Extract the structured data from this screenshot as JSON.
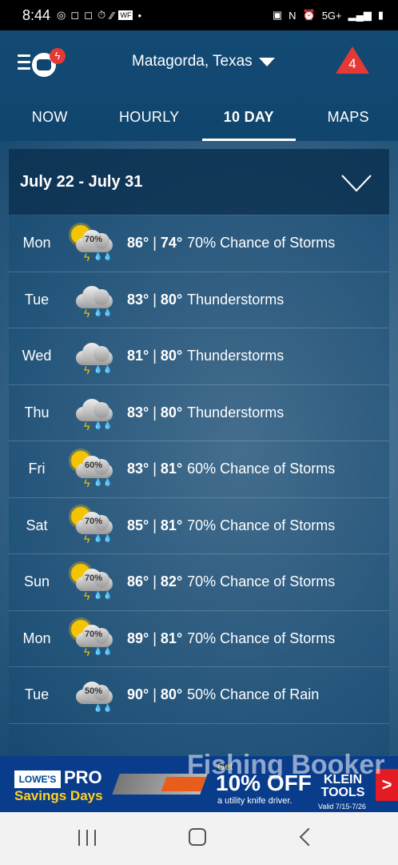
{
  "status_bar": {
    "time": "8:44",
    "left_icons": [
      "threads-icon",
      "instagram-icon",
      "instagram-icon",
      "timer-icon",
      "wifi-calling-icon",
      "wf-icon",
      "dot-icon"
    ],
    "network": "5G+",
    "right_icons": [
      "lock-icon",
      "nfc-icon",
      "alarm-icon",
      "5g-icon",
      "signal-icon",
      "battery-icon"
    ]
  },
  "header": {
    "location": "Matagorda, Texas",
    "alert_count": "4"
  },
  "tabs": [
    {
      "label": "NOW",
      "active": false
    },
    {
      "label": "HOURLY",
      "active": false
    },
    {
      "label": "10 DAY",
      "active": true
    },
    {
      "label": "MAPS",
      "active": false
    }
  ],
  "forecast": {
    "range": "July 22 - July 31",
    "days": [
      {
        "day": "Mon",
        "high": "86°",
        "low": "74°",
        "desc": "70% Chance of Storms",
        "icon": "sun-storm-icon",
        "pct": "70%"
      },
      {
        "day": "Tue",
        "high": "83°",
        "low": "80°",
        "desc": "Thunderstorms",
        "icon": "thunderstorm-icon",
        "pct": ""
      },
      {
        "day": "Wed",
        "high": "81°",
        "low": "80°",
        "desc": "Thunderstorms",
        "icon": "thunderstorm-icon",
        "pct": ""
      },
      {
        "day": "Thu",
        "high": "83°",
        "low": "80°",
        "desc": "Thunderstorms",
        "icon": "thunderstorm-icon",
        "pct": ""
      },
      {
        "day": "Fri",
        "high": "83°",
        "low": "81°",
        "desc": "60% Chance of Storms",
        "icon": "sun-storm-icon",
        "pct": "60%"
      },
      {
        "day": "Sat",
        "high": "85°",
        "low": "81°",
        "desc": "70% Chance of Storms",
        "icon": "sun-storm-icon",
        "pct": "70%"
      },
      {
        "day": "Sun",
        "high": "86°",
        "low": "82°",
        "desc": "70% Chance of Storms",
        "icon": "sun-storm-icon",
        "pct": "70%"
      },
      {
        "day": "Mon",
        "high": "89°",
        "low": "81°",
        "desc": "70% Chance of Storms",
        "icon": "sun-storm-icon",
        "pct": "70%"
      },
      {
        "day": "Tue",
        "high": "90°",
        "low": "80°",
        "desc": "50% Chance of Rain",
        "icon": "rain-icon",
        "pct": "50%"
      }
    ]
  },
  "ad": {
    "brand": "LOWE'S",
    "pro": "PRO",
    "savings": "Savings Days",
    "get": "Get",
    "offer": "10% OFF",
    "sub": "a utility knife driver.",
    "klein": "KLEIN TOOLS",
    "valid": "Valid 7/15-7/26",
    "arrow": ">"
  },
  "watermark": "Fishing Booker",
  "colors": {
    "appbar": "#134a74",
    "alert": "#e53935",
    "sun": "#f5c400",
    "ad_bg": "#0a3c8c",
    "ad_accent": "#ffd21f"
  }
}
